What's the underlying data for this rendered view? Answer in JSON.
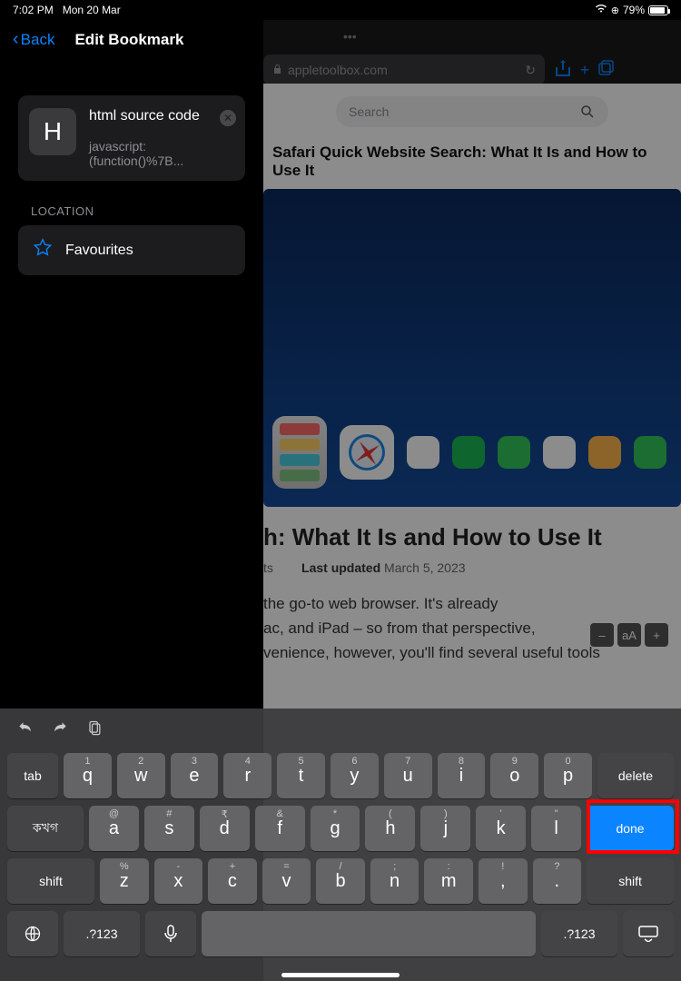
{
  "status": {
    "time": "7:02 PM",
    "date": "Mon 20 Mar",
    "battery": "79%"
  },
  "sidebar": {
    "back": "Back",
    "title": "Edit Bookmark",
    "bookmark": {
      "iconLetter": "H",
      "name": "html source code",
      "url": "javascript:(function()%7B..."
    },
    "locationLabel": "LOCATION",
    "locationValue": "Favourites"
  },
  "browser": {
    "url": "appletoolbox.com",
    "searchPlaceholder": "Search",
    "smallTitle": "Safari Quick Website Search: What It Is and How to Use It",
    "articleTitle": "h: What It Is and How to Use It",
    "metaCategory": "ts",
    "metaUpdatedLabel": "Last updated",
    "metaUpdatedDate": "March 5, 2023",
    "body1": "the go-to web browser. It's already",
    "body2": "ac, and iPad – so from that perspective,",
    "body3": "venience, however, you'll find several useful tools",
    "textcontrols": {
      "minus": "–",
      "aa": "aA",
      "plus": "+"
    }
  },
  "keyboard": {
    "tab": "tab",
    "delete": "delete",
    "done": "done",
    "shift": "shift",
    "alt": ".?123",
    "bangla": "কখগ",
    "row1": [
      {
        "h": "1",
        "k": "q"
      },
      {
        "h": "2",
        "k": "w"
      },
      {
        "h": "3",
        "k": "e"
      },
      {
        "h": "4",
        "k": "r"
      },
      {
        "h": "5",
        "k": "t"
      },
      {
        "h": "6",
        "k": "y"
      },
      {
        "h": "7",
        "k": "u"
      },
      {
        "h": "8",
        "k": "i"
      },
      {
        "h": "9",
        "k": "o"
      },
      {
        "h": "0",
        "k": "p"
      }
    ],
    "row2": [
      {
        "h": "@",
        "k": "a"
      },
      {
        "h": "#",
        "k": "s"
      },
      {
        "h": "₹",
        "k": "d"
      },
      {
        "h": "&",
        "k": "f"
      },
      {
        "h": "*",
        "k": "g"
      },
      {
        "h": "(",
        "k": "h"
      },
      {
        "h": ")",
        "k": "j"
      },
      {
        "h": "'",
        "k": "k"
      },
      {
        "h": "\"",
        "k": "l"
      }
    ],
    "row3": [
      {
        "h": "%",
        "k": "z"
      },
      {
        "h": "-",
        "k": "x"
      },
      {
        "h": "+",
        "k": "c"
      },
      {
        "h": "=",
        "k": "v"
      },
      {
        "h": "/",
        "k": "b"
      },
      {
        "h": ";",
        "k": "n"
      },
      {
        "h": ":",
        "k": "m"
      },
      {
        "h": "!",
        "k": ","
      },
      {
        "h": "?",
        "k": "."
      }
    ]
  }
}
